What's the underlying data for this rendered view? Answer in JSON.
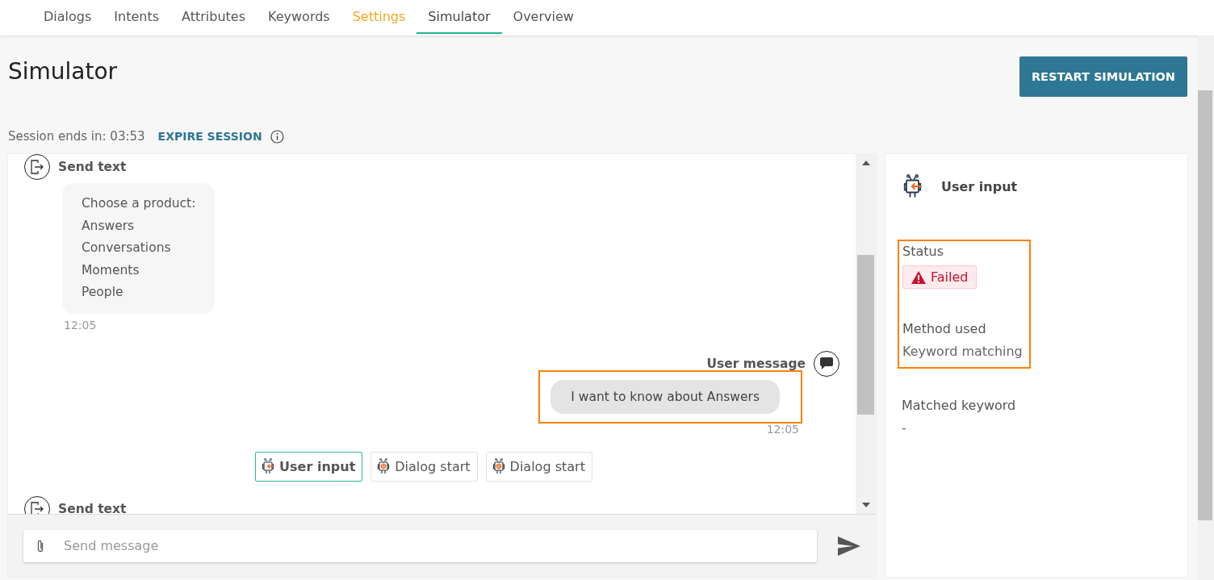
{
  "tabs": [
    {
      "label": "Dialogs",
      "selected": false,
      "highlighted": false
    },
    {
      "label": "Intents",
      "selected": false,
      "highlighted": false
    },
    {
      "label": "Attributes",
      "selected": false,
      "highlighted": false
    },
    {
      "label": "Keywords",
      "selected": false,
      "highlighted": false
    },
    {
      "label": "Settings",
      "selected": false,
      "highlighted": true
    },
    {
      "label": "Simulator",
      "selected": true,
      "highlighted": false
    },
    {
      "label": "Overview",
      "selected": false,
      "highlighted": false
    }
  ],
  "page": {
    "title": "Simulator",
    "restart_button": "RESTART SIMULATION"
  },
  "session": {
    "label": "Session ends in: 03:53",
    "expire_link": "EXPIRE SESSION"
  },
  "chat": {
    "items": [
      {
        "kind": "bot",
        "title": "Send text",
        "lines": [
          "Choose a product:",
          "Answers",
          "Conversations",
          "Moments",
          "People"
        ],
        "time": "12:05"
      },
      {
        "kind": "user",
        "title": "User message",
        "text": "I want to know about Answers",
        "time": "12:05",
        "highlighted": true
      },
      {
        "kind": "steps",
        "steps": [
          {
            "kind": "user_input",
            "label": "User input",
            "selected": true
          },
          {
            "kind": "dialog_start",
            "label": "Dialog start",
            "selected": false
          },
          {
            "kind": "dialog_start",
            "label": "Dialog start",
            "selected": false
          }
        ]
      },
      {
        "kind": "bot",
        "title": "Send text"
      }
    ],
    "input": {
      "placeholder": "Send message"
    }
  },
  "details": {
    "title": "User input",
    "status_label": "Status",
    "status": "Failed",
    "status_highlighted": true,
    "method_label": "Method used",
    "method": "Keyword matching",
    "matched_label": "Matched keyword",
    "matched": "-"
  }
}
